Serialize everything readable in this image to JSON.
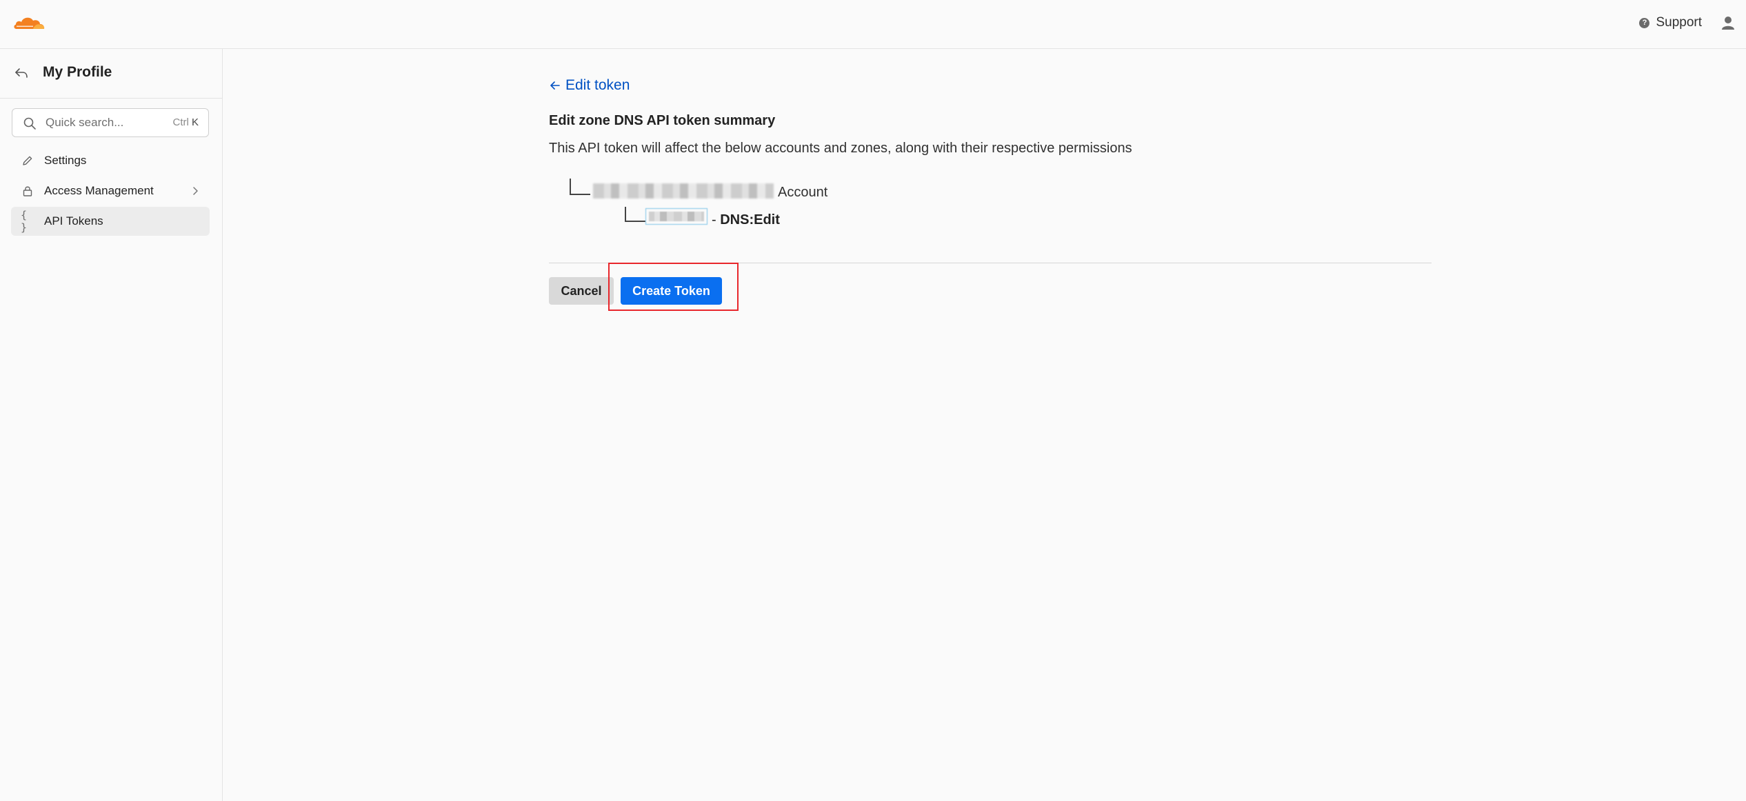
{
  "header": {
    "logo_icon": "cloudflare-logo",
    "support_label": "Support",
    "support_icon": "help-circle-icon",
    "user_icon": "user-icon"
  },
  "sidebar": {
    "title": "My Profile",
    "back_icon": "back-arrow-icon",
    "search": {
      "placeholder": "Quick search...",
      "shortcut_prefix": "Ctrl",
      "shortcut_key": "K"
    },
    "items": [
      {
        "label": "Settings",
        "icon": "pencil-icon",
        "active": false
      },
      {
        "label": "Access Management",
        "icon": "lock-icon",
        "active": false,
        "has_chevron": true
      },
      {
        "label": "API Tokens",
        "icon": "braces-icon",
        "active": true
      }
    ]
  },
  "main": {
    "back_link": "Edit token",
    "summary_title": "Edit zone DNS API token summary",
    "summary_desc": "This API token will affect the below accounts and zones, along with their respective permissions",
    "account_suffix": "Account",
    "permission_sep": "- ",
    "permission": "DNS:Edit",
    "cancel_label": "Cancel",
    "create_label": "Create Token"
  },
  "colors": {
    "accent": "#0a6ff0",
    "link": "#0051c3",
    "highlight": "#e8262b",
    "logo": "#f38020"
  }
}
